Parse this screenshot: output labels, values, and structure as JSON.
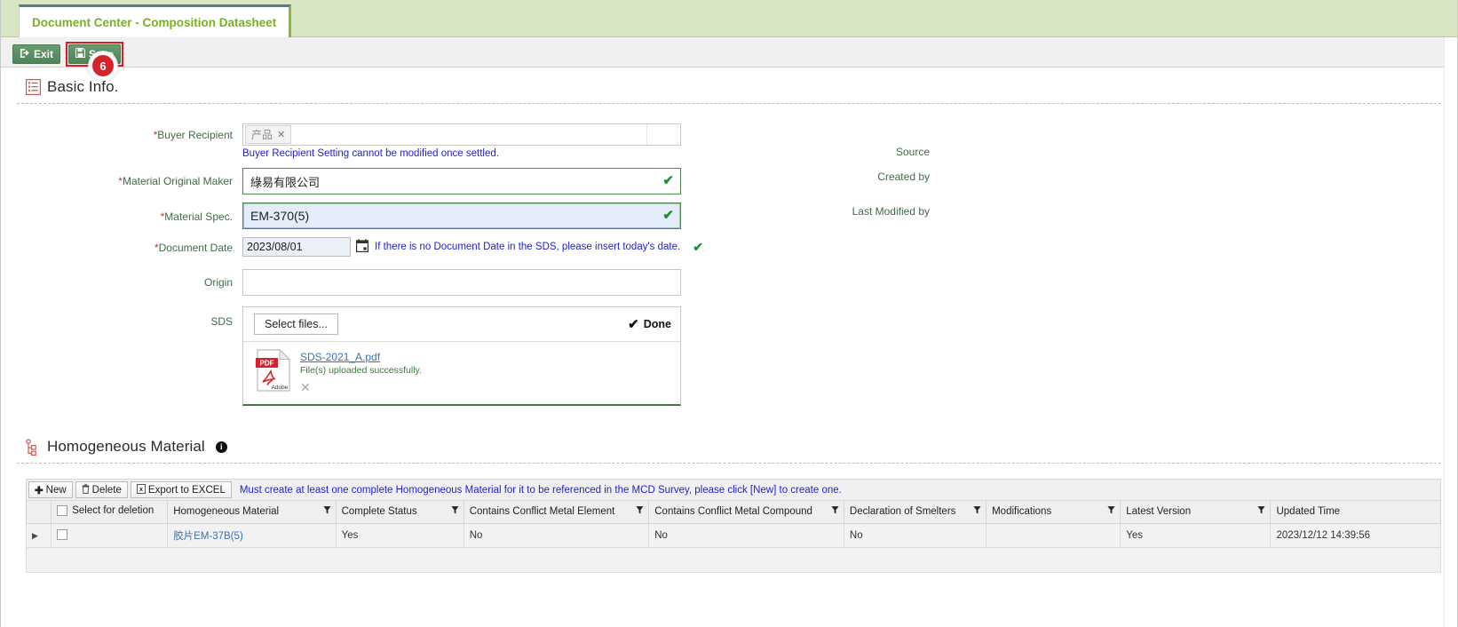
{
  "tab": {
    "label": "Document Center - Composition Datasheet"
  },
  "toolbar": {
    "exit_label": "Exit",
    "save_label": "Save",
    "exit_icon": "exit-arrow-icon",
    "save_icon": "floppy-disk-icon",
    "step_badge": "6"
  },
  "basic_info": {
    "title": "Basic Info.",
    "icon": "list-document-icon",
    "fields": {
      "buyer_recipient": {
        "label": "Buyer Recipient",
        "required": "*",
        "tag": "产品",
        "tag_remove": "✕",
        "hint": "Buyer Recipient Setting cannot be modified once settled."
      },
      "material_original_maker": {
        "label": "Material Original Maker",
        "required": "*",
        "value": "綠易有限公司",
        "valid_mark": "✔"
      },
      "material_spec": {
        "label": "Material Spec.",
        "required": "*",
        "value": "EM-370(5)",
        "valid_mark": "✔"
      },
      "document_date": {
        "label": "Document Date",
        "required": "*",
        "value": "2023/08/01",
        "calendar_icon": "calendar-icon",
        "hint": "If there is no Document Date in the SDS, please insert today's date.",
        "valid_mark": "✔"
      },
      "origin": {
        "label": "Origin",
        "value": ""
      },
      "sds": {
        "label": "SDS",
        "select_files_label": "Select files...",
        "done_label": "Done",
        "done_mark": "✔",
        "file_name": "SDS-2021_A.pdf",
        "file_status": "File(s) uploaded successfully.",
        "file_type_badge": "PDF",
        "file_brand": "Adobe",
        "remove_mark": "✕"
      }
    },
    "meta": {
      "source_label": "Source",
      "created_by_label": "Created by",
      "last_modified_by_label": "Last Modified by"
    }
  },
  "homogeneous_material": {
    "title": "Homogeneous Material",
    "icon": "tree-hierarchy-icon",
    "info_icon": "info-icon",
    "info_glyph": "i",
    "toolbar": {
      "new_label": "New",
      "new_icon": "plus-icon",
      "delete_label": "Delete",
      "delete_icon": "trash-icon",
      "export_label": "Export to EXCEL",
      "export_icon": "excel-icon",
      "note": "Must create at least one complete Homogeneous Material for it to be referenced in the MCD Survey, please click [New] to create one."
    },
    "grid": {
      "columns": [
        {
          "label": "",
          "filter": false
        },
        {
          "label": "Select for deletion",
          "filter": false,
          "checkbox": true
        },
        {
          "label": "Homogeneous Material",
          "filter": true
        },
        {
          "label": "Complete Status",
          "filter": true
        },
        {
          "label": "Contains Conflict Metal Element",
          "filter": true
        },
        {
          "label": "Contains Conflict Metal Compound",
          "filter": true
        },
        {
          "label": "Declaration of Smelters",
          "filter": true
        },
        {
          "label": "Modifications",
          "filter": true
        },
        {
          "label": "Latest Version",
          "filter": true
        },
        {
          "label": "Updated Time",
          "filter": false
        }
      ],
      "rows": [
        {
          "expander": "▶",
          "selected": false,
          "homogeneous_material": "胶片EM-37B(5)",
          "complete_status": "Yes",
          "contains_conflict_metal_element": "No",
          "contains_conflict_metal_compound": "No",
          "declaration_of_smelters": "No",
          "modifications": "",
          "latest_version": "Yes",
          "updated_time": "2023/12/12 14:39:56"
        }
      ]
    }
  },
  "colors": {
    "tab_strip_bg": "#d9e6c3",
    "tab_text": "#7ab11d",
    "button_green": "#5b8f63",
    "highlight_red": "#e01b1b",
    "hint_blue": "#2020e0",
    "label_green": "#3f6b47",
    "required_red": "#d2322d",
    "valid_green": "#1e9139",
    "link_blue": "#3a72b8"
  }
}
